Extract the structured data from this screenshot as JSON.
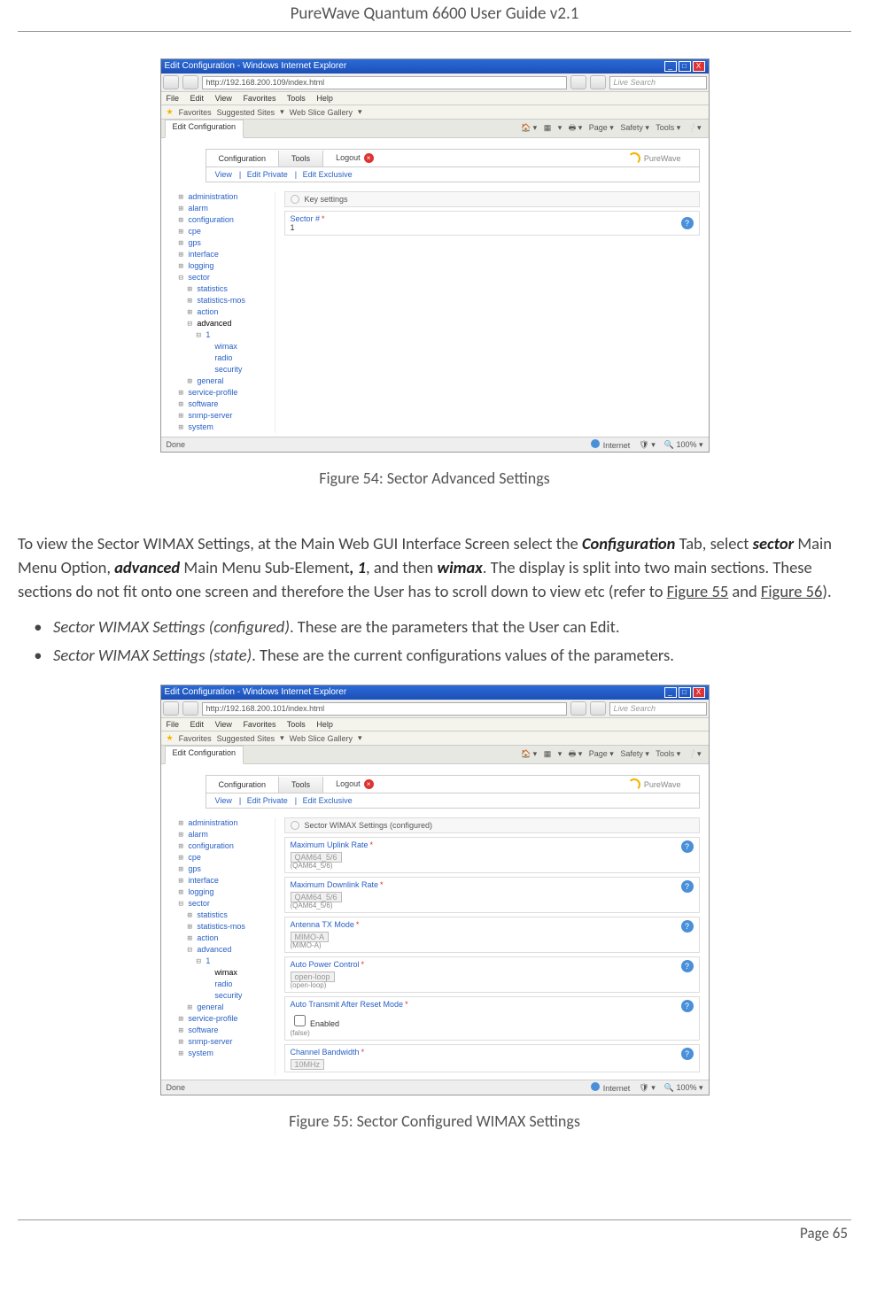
{
  "doc": {
    "headerTitle": "PureWave Quantum 6600 User Guide v2.1",
    "pageLabel": "Page 65",
    "figure54Caption": "Figure 54: Sector Advanced Settings",
    "figure55Caption": "Figure 55: Sector Configured WIMAX Settings",
    "paragraph_pre": "To view the Sector WIMAX Settings, at the Main Web GUI Interface Screen select the ",
    "configTab": "Configuration",
    "paragraph_p2": " Tab, select ",
    "sector": "sector",
    "paragraph_p3": " Main Menu Option, ",
    "advanced": "advanced",
    "paragraph_p4": " Main Menu Sub-Element",
    "one": ", 1",
    "paragraph_p5": ", and then ",
    "wimax": "wimax",
    "paragraph_p6": ". The display is split into two main sections. These sections do not fit onto one screen and therefore the User has to scroll down to view etc (refer to ",
    "fig55ref": "Figure 55",
    "and": " and ",
    "fig56ref": "Figure 56",
    "paragraph_end": ").",
    "bullet1_b": "Sector WIMAX Settings (configured)",
    "bullet1_t": ". These are the parameters that the User can Edit.",
    "bullet2_b": "Sector WIMAX Settings (state)",
    "bullet2_t": ". These are the current configurations values of the parameters."
  },
  "ss": {
    "windowTitle": "Edit Configuration - Windows Internet Explorer",
    "url1": "http://192.168.200.109/index.html",
    "url2": "http://192.168.200.101/index.html",
    "liveSearch": "Live Search",
    "menu": {
      "file": "File",
      "edit": "Edit",
      "view": "View",
      "favorites": "Favorites",
      "tools": "Tools",
      "help": "Help"
    },
    "favLabel": "Favorites",
    "suggested": "Suggested Sites",
    "webslice": "Web Slice Gallery",
    "tabLabel": "Edit Configuration",
    "toolbarPage": "Page",
    "toolbarSafety": "Safety",
    "toolbarTools": "Tools",
    "navConfig": "Configuration",
    "navTools": "Tools",
    "logout": "Logout",
    "brand": "PureWave",
    "subView": "View",
    "subEditPrivate": "Edit Private",
    "subEditExclusive": "Edit Exclusive",
    "tree": {
      "administration": "administration",
      "alarm": "alarm",
      "configuration": "configuration",
      "cpe": "cpe",
      "gps": "gps",
      "interface": "interface",
      "logging": "logging",
      "sector": "sector",
      "statistics": "statistics",
      "statisticsmos": "statistics-mos",
      "action": "action",
      "advanced": "advanced",
      "one": "1",
      "wimax": "wimax",
      "radio": "radio",
      "security": "security",
      "general": "general",
      "serviceprofile": "service-profile",
      "software": "software",
      "snmpserver": "snmp-server",
      "system": "system"
    },
    "keySettings": "Key settings",
    "sectorNum": "Sector #",
    "sectorVal": "1",
    "panelTitle": "Sector WIMAX Settings (configured)",
    "fields": {
      "maxUplink": "Maximum Uplink Rate",
      "maxUplinkVal": "QAM64_5/6",
      "maxUplinkNote": "(QAM64_5/6)",
      "maxDownlink": "Maximum Downlink Rate",
      "maxDownlinkVal": "QAM64_5/6",
      "maxDownlinkNote": "(QAM64_5/6)",
      "antenna": "Antenna TX Mode",
      "antennaVal": "MIMO-A",
      "antennaNote": "(MIMO-A)",
      "apc": "Auto Power Control",
      "apcVal": "open-loop",
      "apcNote": "(open-loop)",
      "autoTx": "Auto Transmit After Reset Mode",
      "autoTxVal": "Enabled",
      "autoTxNote": "(false)",
      "chbw": "Channel Bandwidth",
      "chbwVal": "10MHz"
    },
    "statusDone": "Done",
    "statusInternet": "Internet",
    "statusZoom": "100%"
  }
}
